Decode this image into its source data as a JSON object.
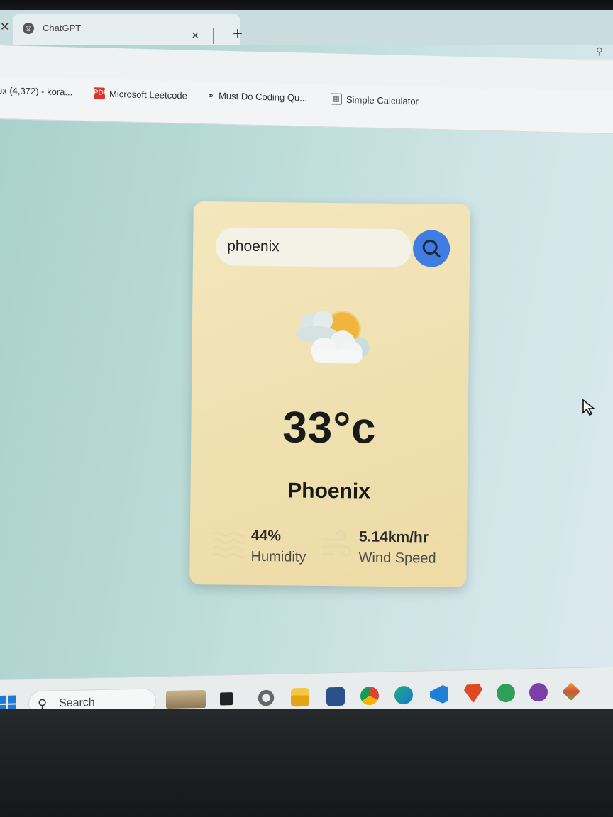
{
  "browser": {
    "tab_title": "ChatGPT",
    "tab_close": "×",
    "new_tab": "+"
  },
  "bookmarks": [
    {
      "label": "ox (4,372) - kora...",
      "icon": "mail-icon"
    },
    {
      "label": "Microsoft Leetcode",
      "icon": "pdf-icon",
      "icon_text": "PDF"
    },
    {
      "label": "Must Do Coding Qu...",
      "icon": "link-icon"
    },
    {
      "label": "Simple Calculator",
      "icon": "calculator-icon"
    }
  ],
  "weather": {
    "search_value": "phoenix",
    "temperature": "33°c",
    "city": "Phoenix",
    "humidity_value": "44%",
    "humidity_label": "Humidity",
    "wind_value": "5.14km/hr",
    "wind_label": "Wind Speed"
  },
  "taskbar": {
    "search_label": "Search"
  },
  "colors": {
    "card_background": "#efe0b0",
    "search_button": "#3f7de0",
    "screen_background": "#bcdcd8"
  }
}
